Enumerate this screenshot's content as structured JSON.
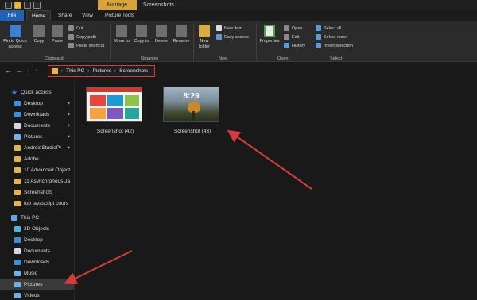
{
  "window": {
    "contextual_tab": "Manage",
    "title": "Screenshots"
  },
  "ribbon_tabs": [
    "File",
    "Home",
    "Share",
    "View",
    "Picture Tools"
  ],
  "ribbon": {
    "clipboard": {
      "pin_quick_access": "Pin to Quick access",
      "copy": "Copy",
      "paste": "Paste",
      "cut": "Cut",
      "copy_path": "Copy path",
      "paste_shortcut": "Paste shortcut",
      "group_label": "Clipboard"
    },
    "organize": {
      "move_to": "Move to",
      "copy_to": "Copy to",
      "delete": "Delete",
      "rename": "Rename",
      "group_label": "Organize"
    },
    "new": {
      "new_folder": "New folder",
      "new_item": "New item",
      "easy_access": "Easy access",
      "group_label": "New"
    },
    "open": {
      "properties": "Properties",
      "open": "Open",
      "edit": "Edit",
      "history": "History",
      "group_label": "Open"
    },
    "select": {
      "select_all": "Select all",
      "select_none": "Select none",
      "invert_selection": "Invert selection",
      "group_label": "Select"
    }
  },
  "address": {
    "crumbs": [
      "This PC",
      "Pictures",
      "Screenshots"
    ],
    "highlight_color": "#d93a3a"
  },
  "sidebar": {
    "quick_access": "Quick access",
    "quick_items": [
      "Desktop",
      "Downloads",
      "Documents",
      "Pictures",
      "AndroidStudioPr",
      "Adobe",
      "10 Advanced Object",
      "11 Asynchronous Ja",
      "Screenshots",
      "top javascript cours"
    ],
    "this_pc": "This PC",
    "pc_items": [
      "3D Objects",
      "Desktop",
      "Documents",
      "Downloads",
      "Music",
      "Pictures",
      "Videos"
    ],
    "selected": "Pictures"
  },
  "files": [
    {
      "name": "Screenshot (42)"
    },
    {
      "name": "Screenshot (43)",
      "clock": "8:29"
    }
  ],
  "annotation_color": "#d93a3a"
}
